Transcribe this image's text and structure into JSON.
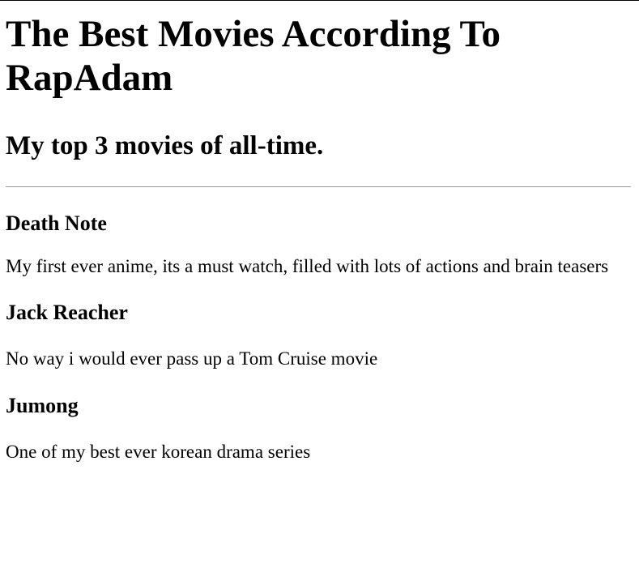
{
  "page": {
    "title": "The Best Movies According To RapAdam",
    "subtitle": "My top 3 movies of all-time."
  },
  "movies": [
    {
      "title": "Death Note",
      "description": "My first ever anime, its a must watch, filled with lots of actions and brain teasers"
    },
    {
      "title": "Jack Reacher",
      "description": "No way i would ever pass up a Tom Cruise movie"
    },
    {
      "title": "Jumong",
      "description": "One of my best ever korean drama series"
    }
  ],
  "colors": {
    "background": "#ffffff",
    "text": "#000000",
    "divider": "#9a9a9a"
  }
}
